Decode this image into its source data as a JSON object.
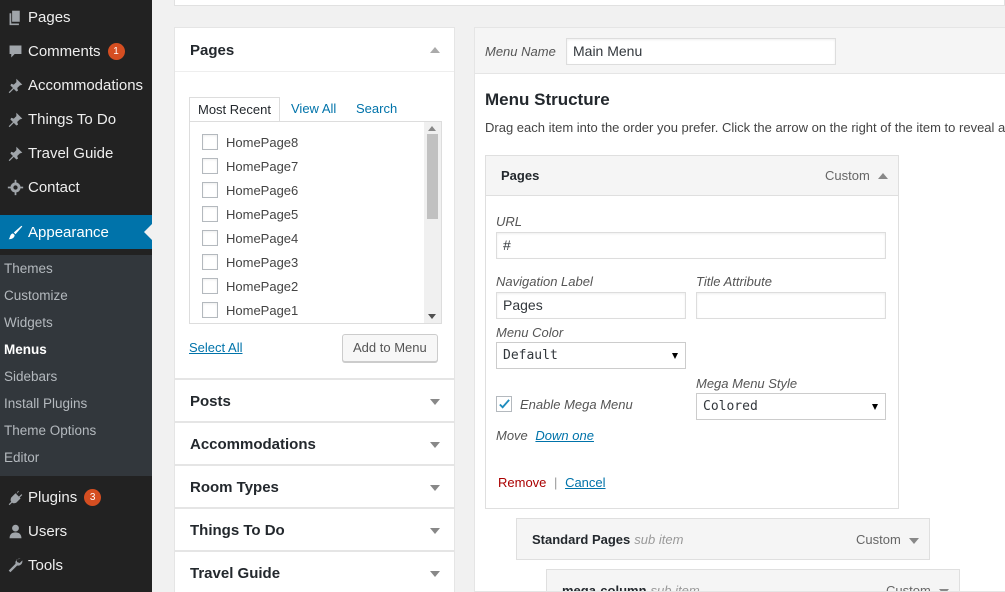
{
  "sidebar": {
    "items": [
      {
        "label": "Pages",
        "icon": "pages-icon"
      },
      {
        "label": "Comments",
        "icon": "comments-icon",
        "badge": "1"
      },
      {
        "label": "Accommodations",
        "icon": "pin-icon"
      },
      {
        "label": "Things To Do",
        "icon": "pin-icon"
      },
      {
        "label": "Travel Guide",
        "icon": "pin-icon"
      },
      {
        "label": "Contact",
        "icon": "gear-icon"
      },
      {
        "label": "Appearance",
        "icon": "brush-icon"
      },
      {
        "label": "Plugins",
        "icon": "plugin-icon",
        "badge": "3"
      },
      {
        "label": "Users",
        "icon": "user-icon"
      },
      {
        "label": "Tools",
        "icon": "wrench-icon"
      }
    ],
    "submenu": [
      "Themes",
      "Customize",
      "Widgets",
      "Menus",
      "Sidebars",
      "Install Plugins",
      "Theme Options",
      "Editor"
    ],
    "active_submenu": "Menus"
  },
  "left": {
    "pages_panel": {
      "title": "Pages",
      "tabs": [
        "Most Recent",
        "View All",
        "Search"
      ],
      "active_tab": "Most Recent",
      "items": [
        "HomePage8",
        "HomePage7",
        "HomePage6",
        "HomePage5",
        "HomePage4",
        "HomePage3",
        "HomePage2",
        "HomePage1"
      ],
      "select_all": "Select All",
      "add_button": "Add to Menu"
    },
    "collapsed_panels": [
      "Posts",
      "Accommodations",
      "Room Types",
      "Things To Do",
      "Travel Guide"
    ]
  },
  "right": {
    "menu_name_label": "Menu Name",
    "menu_name_value": "Main Menu",
    "structure_title": "Menu Structure",
    "structure_help": "Drag each item into the order you prefer. Click the arrow on the right of the item to reveal additional configuration options.",
    "item": {
      "title": "Pages",
      "type": "Custom",
      "url_label": "URL",
      "url_value": "#",
      "nav_label": "Navigation Label",
      "nav_value": "Pages",
      "title_attr_label": "Title Attribute",
      "title_attr_value": "",
      "menu_color_label": "Menu Color",
      "menu_color_value": "Default",
      "mega_enable_label": "Enable Mega Menu",
      "mega_enable_checked": true,
      "mega_style_label": "Mega Menu Style",
      "mega_style_value": "Colored",
      "move_label": "Move",
      "move_link": "Down one",
      "remove": "Remove",
      "separator": "|",
      "cancel": "Cancel"
    },
    "sub_items": [
      {
        "title": "Standard Pages",
        "sub": "sub item",
        "type": "Custom"
      },
      {
        "title": "mega-column",
        "sub": "sub item",
        "type": "Custom"
      }
    ]
  },
  "colors": {
    "sidebar_bg": "#222222",
    "accent": "#0073aa",
    "badge": "#d54e21",
    "remove": "#a00000"
  }
}
